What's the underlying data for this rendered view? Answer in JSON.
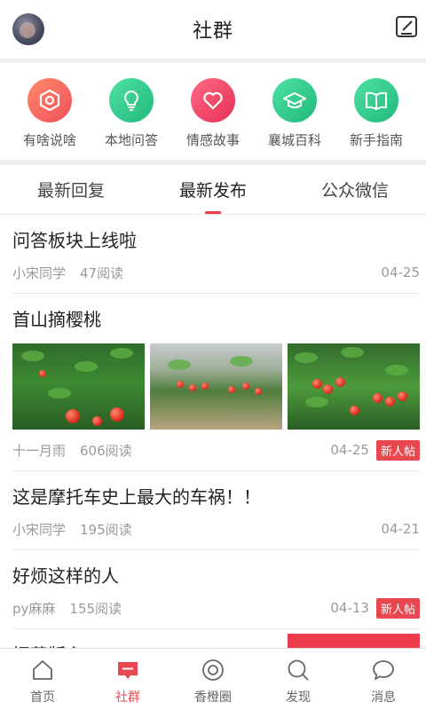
{
  "header": {
    "title": "社群"
  },
  "categories": [
    {
      "label": "有啥说啥",
      "icon": "camera-hex-icon",
      "color": "#f26b5b"
    },
    {
      "label": "本地问答",
      "icon": "lightbulb-icon",
      "color": "#35c98a"
    },
    {
      "label": "情感故事",
      "icon": "heart-icon",
      "color": "#ee3f62"
    },
    {
      "label": "襄城百科",
      "icon": "graduation-cap-icon",
      "color": "#31c98c"
    },
    {
      "label": "新手指南",
      "icon": "book-icon",
      "color": "#35c98a"
    }
  ],
  "tabs": [
    {
      "label": "最新回复",
      "active": false
    },
    {
      "label": "最新发布",
      "active": true
    },
    {
      "label": "公众微信",
      "active": false
    }
  ],
  "posts": [
    {
      "title": "问答板块上线啦",
      "author": "小宋同学",
      "reads": "47阅读",
      "date": "04-25",
      "badge": ""
    },
    {
      "title": "首山摘樱桃",
      "author": "十一月雨",
      "reads": "606阅读",
      "date": "04-25",
      "badge": "新人帖"
    },
    {
      "title": "这是摩托车史上最大的车祸！！",
      "author": "小宋同学",
      "reads": "195阅读",
      "date": "04-21",
      "badge": ""
    },
    {
      "title": "好烦这样的人",
      "author": "py麻麻",
      "reads": "155阅读",
      "date": "04-13",
      "badge": "新人帖"
    },
    {
      "title": "招募版主！",
      "author": "",
      "reads": "",
      "date": "",
      "badge": ""
    }
  ],
  "bottom_nav": [
    {
      "label": "首页",
      "icon": "home-icon",
      "active": false
    },
    {
      "label": "社群",
      "icon": "chat-bubble-icon",
      "active": true
    },
    {
      "label": "香橙圈",
      "icon": "circle-target-icon",
      "active": false
    },
    {
      "label": "发现",
      "icon": "search-icon",
      "active": false
    },
    {
      "label": "消息",
      "icon": "message-icon",
      "active": false
    }
  ],
  "colors": {
    "accent": "#ee3b4d",
    "badge": "#e9474f"
  }
}
